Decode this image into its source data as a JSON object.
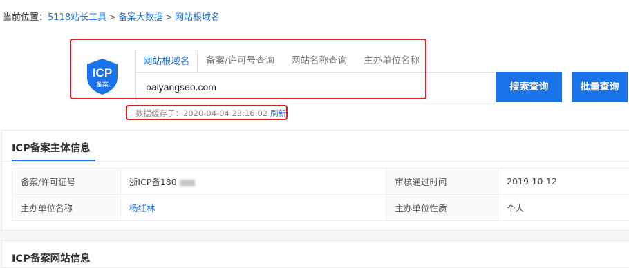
{
  "breadcrumb": {
    "prefix": "当前位置：",
    "items": [
      "5118站长工具",
      "备案大数据",
      "网站根域名"
    ],
    "separator": ">"
  },
  "logo": {
    "text": "ICP",
    "subtext": "备案",
    "color": "#1a73e8"
  },
  "tabs": [
    {
      "label": "网站根域名",
      "active": true
    },
    {
      "label": "备案/许可号查询",
      "active": false
    },
    {
      "label": "网站名称查询",
      "active": false
    },
    {
      "label": "主办单位名称",
      "active": false
    }
  ],
  "search": {
    "value": "baiyangseo.com"
  },
  "buttons": {
    "search": "搜索查询",
    "batch": "批量查询"
  },
  "cache": {
    "label": "数据缓存于：2020-04-04 23:16:02",
    "refresh": "刷新"
  },
  "panel_main": {
    "title": "ICP备案主体信息",
    "rows": [
      {
        "k1": "备案/许可证号",
        "v1": "浙ICP备180",
        "k2": "审核通过时间",
        "v2": "2019-10-12"
      },
      {
        "k1": "主办单位名称",
        "v1": "杨红林",
        "k2": "主办单位性质",
        "v2": "个人"
      }
    ]
  },
  "panel_site": {
    "title": "ICP备案网站信息"
  },
  "colors": {
    "accent": "#1a73e8",
    "highlight": "#e11b22"
  }
}
